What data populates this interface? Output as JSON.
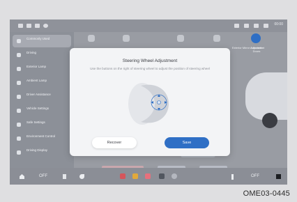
{
  "status_bar": {
    "time": "00:00"
  },
  "sidebar": {
    "items": [
      {
        "label": "Commonly Used",
        "icon": "star-icon",
        "active": true
      },
      {
        "label": "Driving",
        "icon": "car-icon"
      },
      {
        "label": "Exterior Lamp",
        "icon": "lamp-icon"
      },
      {
        "label": "Ambient Lamp",
        "icon": "ambient-lamp-icon"
      },
      {
        "label": "Driver Assistance",
        "icon": "assist-icon"
      },
      {
        "label": "Vehicle Settings",
        "icon": "vehicle-icon"
      },
      {
        "label": "Safe Settings",
        "icon": "shield-icon"
      },
      {
        "label": "Environment Control",
        "icon": "leaf-icon"
      },
      {
        "label": "Driving Display",
        "icon": "display-icon"
      }
    ]
  },
  "top_tiles": {
    "exterior_mirror_label": "Exterior Mirror Adjustment",
    "automatic_doors_label": "Automatic Doors"
  },
  "background_panel": {
    "label": "Seat Position"
  },
  "modal": {
    "title": "Steering Wheel Adjustment",
    "description": "Use the buttons on the right of steering wheel to adjust the position of steering wheel",
    "recover_label": "Recover",
    "save_label": "Save"
  },
  "taskbar": {
    "left_status": "OFF",
    "right_status": "OFF"
  },
  "caption": "OME03-0445",
  "colors": {
    "accent": "#2f6fc5",
    "modal_bg": "#f3f4f6"
  }
}
